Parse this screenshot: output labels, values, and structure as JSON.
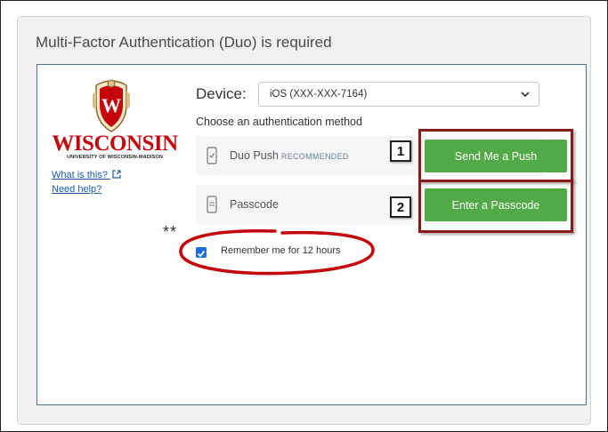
{
  "heading": "Multi-Factor Authentication (Duo) is required",
  "logo": {
    "word": "WISCONSIN",
    "sub": "UNIVERSITY OF WISCONSIN-MADISON",
    "crest_letter": "W"
  },
  "links": {
    "what_is_this": "What is this?",
    "need_help": "Need help?"
  },
  "device": {
    "label": "Device:",
    "selected": "iOS (XXX-XXX-7164)"
  },
  "choose_label": "Choose an authentication method",
  "methods": [
    {
      "label": "Duo Push",
      "tag": "RECOMMENDED",
      "button": "Send Me a Push",
      "badge": "1",
      "icon": "phone-check-icon"
    },
    {
      "label": "Passcode",
      "tag": "",
      "button": "Enter a Passcode",
      "badge": "2",
      "icon": "keypad-phone-icon"
    }
  ],
  "remember": {
    "label": "Remember me for 12 hours",
    "checked": true,
    "note": "**"
  },
  "colors": {
    "accent_green": "#51aa45",
    "annotation_red": "#c5050c",
    "brand_red": "#c5050c",
    "checkbox_blue": "#1e6fd9"
  }
}
